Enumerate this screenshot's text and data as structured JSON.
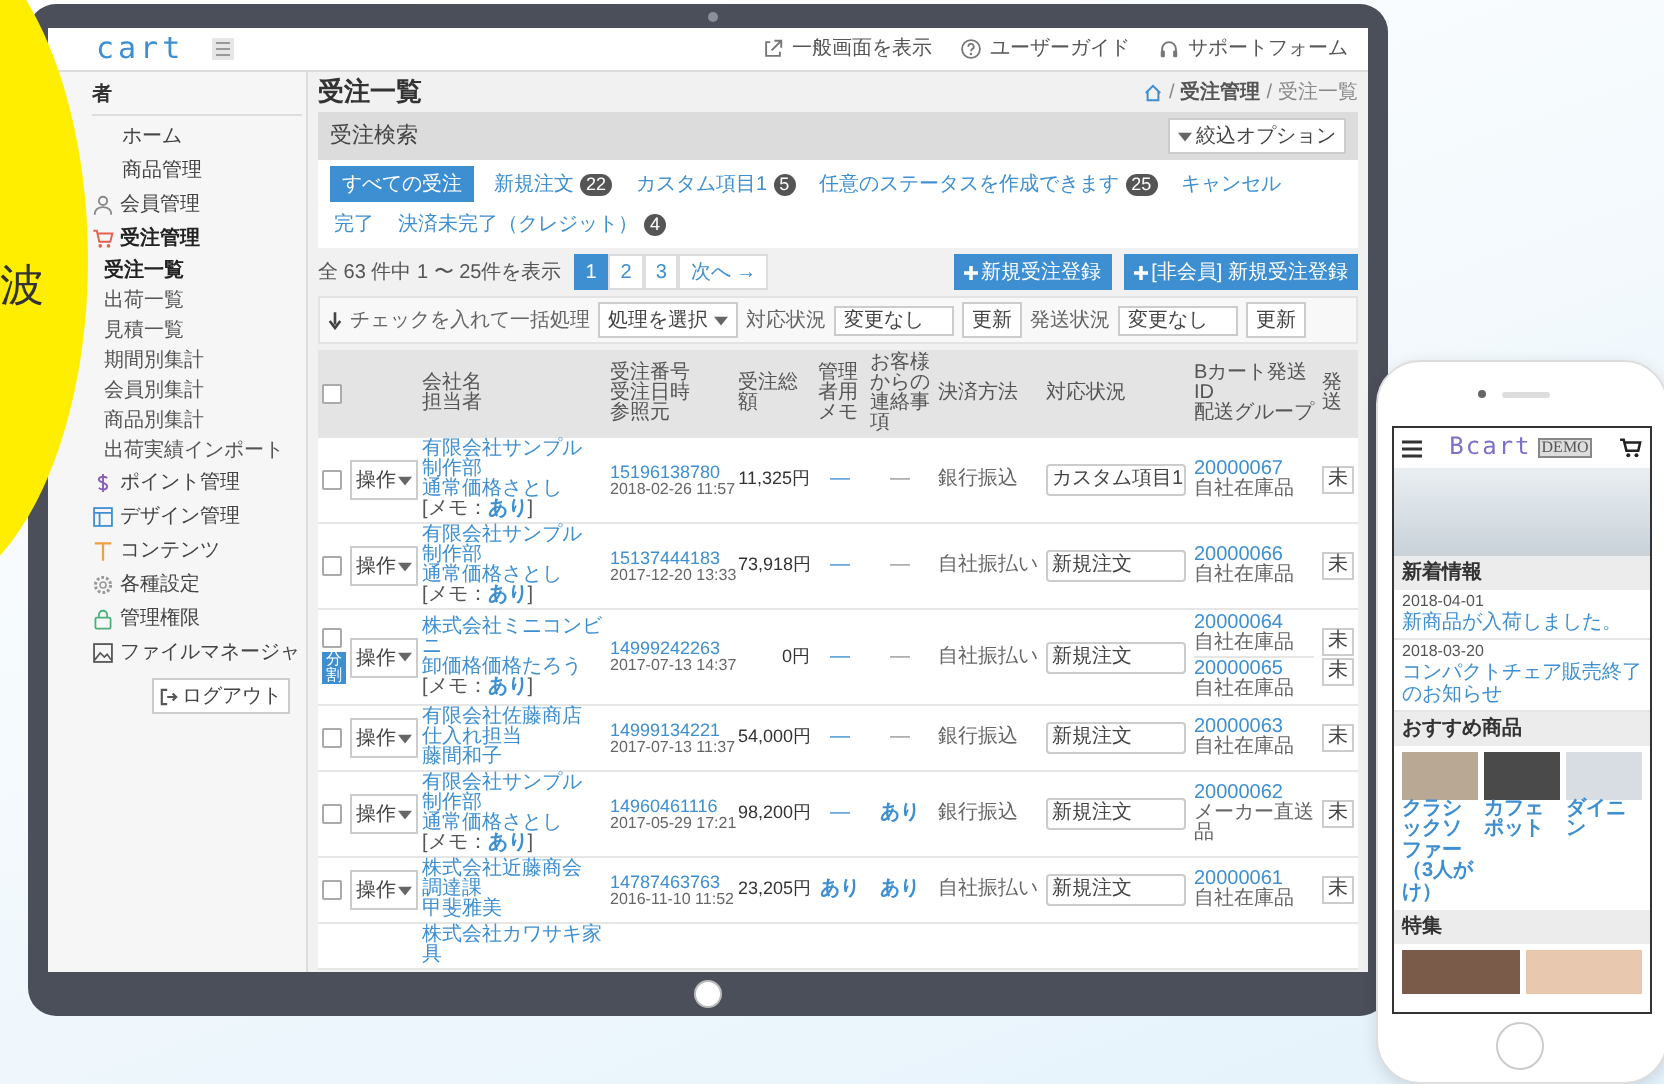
{
  "decoration": {
    "text": "波"
  },
  "admin": {
    "logo": "cart",
    "header_links": [
      {
        "kind": "external",
        "label": "一般画面を表示"
      },
      {
        "kind": "help",
        "label": "ユーザーガイド"
      },
      {
        "kind": "headset",
        "label": "サポートフォーム"
      }
    ],
    "sidebar": {
      "heading": "者",
      "items": [
        {
          "label": "ホーム",
          "kind": "none",
          "selected": false
        },
        {
          "label": "商品管理",
          "kind": "none",
          "selected": false
        },
        {
          "label": "会員管理",
          "kind": "person",
          "selected": false
        },
        {
          "label": "受注管理",
          "kind": "cart",
          "selected": true,
          "children": [
            {
              "label": "受注一覧",
              "selected": true
            },
            {
              "label": "出荷一覧",
              "selected": false
            },
            {
              "label": "見積一覧",
              "selected": false
            },
            {
              "label": "期間別集計",
              "selected": false
            },
            {
              "label": "会員別集計",
              "selected": false
            },
            {
              "label": "商品別集計",
              "selected": false
            },
            {
              "label": "出荷実績インポート",
              "selected": false
            }
          ]
        },
        {
          "label": "ポイント管理",
          "kind": "dollar",
          "selected": false
        },
        {
          "label": "デザイン管理",
          "kind": "layout",
          "selected": false
        },
        {
          "label": "コンテンツ",
          "kind": "text",
          "selected": false
        },
        {
          "label": "各種設定",
          "kind": "gear",
          "selected": false
        },
        {
          "label": "管理権限",
          "kind": "lock",
          "selected": false
        },
        {
          "label": "ファイルマネージャ",
          "kind": "image",
          "selected": false
        }
      ],
      "logout": "ログアウト"
    },
    "page_title": "受注一覧",
    "breadcrumb": [
      "受注管理",
      "受注一覧"
    ],
    "breadcrumb_separator": "/",
    "search": {
      "title": "受注検索",
      "filter_button": "絞込オプション",
      "tabs": [
        {
          "label": "すべての受注",
          "selected": true
        },
        {
          "label": "新規注文",
          "count": "22",
          "selected": false
        },
        {
          "label": "カスタム項目1",
          "count": "5",
          "selected": false
        },
        {
          "label": "任意のステータスを作成できます",
          "count": "25",
          "selected": false
        },
        {
          "label": "キャンセル",
          "selected": false
        },
        {
          "label": "完了",
          "selected": false
        },
        {
          "label": "決済未完了（クレジット）",
          "count": "4",
          "selected": false
        }
      ]
    },
    "result_count": "全 63 件中 1 〜 25件を表示",
    "pages": [
      {
        "label": "1",
        "selected": true
      },
      {
        "label": "2",
        "selected": false
      },
      {
        "label": "3",
        "selected": false
      },
      {
        "label": "次へ →",
        "selected": false
      }
    ],
    "action_buttons": [
      "新規受注登録",
      "[非会員] 新規受注登録"
    ],
    "bulk": {
      "label": "チェックを入れて一括処理",
      "action_select": "処理を選択",
      "fields": [
        {
          "label": "対応状況",
          "value": "変更なし",
          "button": "更新"
        },
        {
          "label": "発送状況",
          "value": "変更なし",
          "button": "更新"
        }
      ]
    },
    "table": {
      "select_all_checked": false,
      "columns": [
        [
          "会社名",
          "担当者"
        ],
        [
          "受注番号",
          "受注日時",
          "参照元"
        ],
        [
          "受注総額"
        ],
        [
          "管理者用",
          "メモ"
        ],
        [
          "お客様からの",
          "連絡事項"
        ],
        [
          "決済方法"
        ],
        [
          "対応状況"
        ],
        [
          "Bカート発送ID",
          "配送グループ"
        ],
        [
          "発送"
        ]
      ],
      "rows": [
        {
          "checked": false,
          "action": "操作",
          "company": [
            "有限会社サンプル",
            "制作部",
            "通常価格さとし"
          ],
          "memo_note": "[メモ：**あり**]",
          "order_no": "15196138780",
          "date": "2018-02-26 11:57",
          "total": "11,325円",
          "memo": "—",
          "contact": "—",
          "payment": "銀行振込",
          "status": "カスタム項目1",
          "shipments": [
            {
              "id": "20000067",
              "group": "自社在庫品",
              "state": "未"
            }
          ]
        },
        {
          "checked": false,
          "action": "操作",
          "company": [
            "有限会社サンプル",
            "制作部",
            "通常価格さとし"
          ],
          "memo_note": "[メモ：**あり**]",
          "order_no": "15137444183",
          "date": "2017-12-20 13:33",
          "total": "73,918円",
          "memo": "—",
          "contact": "—",
          "payment": "自社振払い",
          "status": "新規注文",
          "shipments": [
            {
              "id": "20000066",
              "group": "自社在庫品",
              "state": "未"
            }
          ]
        },
        {
          "checked": false,
          "badge": "分割",
          "action": "操作",
          "company": [
            "株式会社ミニコンビニ",
            "卸価格価格たろう"
          ],
          "memo_note": "[メモ：**あり**]",
          "order_no": "14999242263",
          "date": "2017-07-13 14:37",
          "total": "0円",
          "memo": "—",
          "contact": "—",
          "payment": "自社振払い",
          "status": "新規注文",
          "shipments": [
            {
              "id": "20000064",
              "group": "自社在庫品",
              "state": "未"
            },
            {
              "id": "20000065",
              "group": "自社在庫品",
              "state": "未"
            }
          ]
        },
        {
          "checked": false,
          "action": "操作",
          "company": [
            "有限会社佐藤商店",
            "仕入れ担当",
            "藤間和子"
          ],
          "order_no": "14999134221",
          "date": "2017-07-13 11:37",
          "total": "54,000円",
          "memo": "—",
          "contact": "—",
          "payment": "銀行振込",
          "status": "新規注文",
          "shipments": [
            {
              "id": "20000063",
              "group": "自社在庫品",
              "state": "未"
            }
          ]
        },
        {
          "checked": false,
          "action": "操作",
          "company": [
            "有限会社サンプル",
            "制作部",
            "通常価格さとし"
          ],
          "memo_note": "[メモ：**あり**]",
          "order_no": "14960461116",
          "date": "2017-05-29 17:21",
          "total": "98,200円",
          "memo": "—",
          "contact": "あり",
          "payment": "銀行振込",
          "status": "新規注文",
          "shipments": [
            {
              "id": "20000062",
              "group": "メーカー直送品",
              "state": "未"
            }
          ]
        },
        {
          "checked": false,
          "action": "操作",
          "company": [
            "株式会社近藤商会",
            "調達課",
            "甲斐雅美"
          ],
          "order_no": "14787463763",
          "date": "2016-11-10 11:52",
          "total": "23,205円",
          "memo": "あり",
          "contact": "あり",
          "payment": "自社振払い",
          "status": "新規注文",
          "shipments": [
            {
              "id": "20000061",
              "group": "自社在庫品",
              "state": "未"
            }
          ]
        },
        {
          "company": [
            "株式会社カワサキ家具"
          ]
        }
      ]
    }
  },
  "phone": {
    "logo": "Bcart",
    "badge": "DEMO",
    "news": {
      "title": "新着情報",
      "items": [
        {
          "date": "2018-04-01",
          "text": "新商品が入荷しました。"
        },
        {
          "date": "2018-03-20",
          "text": "コンパクトチェア販売終了のお知らせ"
        }
      ]
    },
    "recommended": {
      "title": "おすすめ商品",
      "products": [
        "クラシックソファー（3人がけ）",
        "カフェポット",
        "ダイニン"
      ]
    },
    "feature": {
      "title": "特集"
    }
  }
}
